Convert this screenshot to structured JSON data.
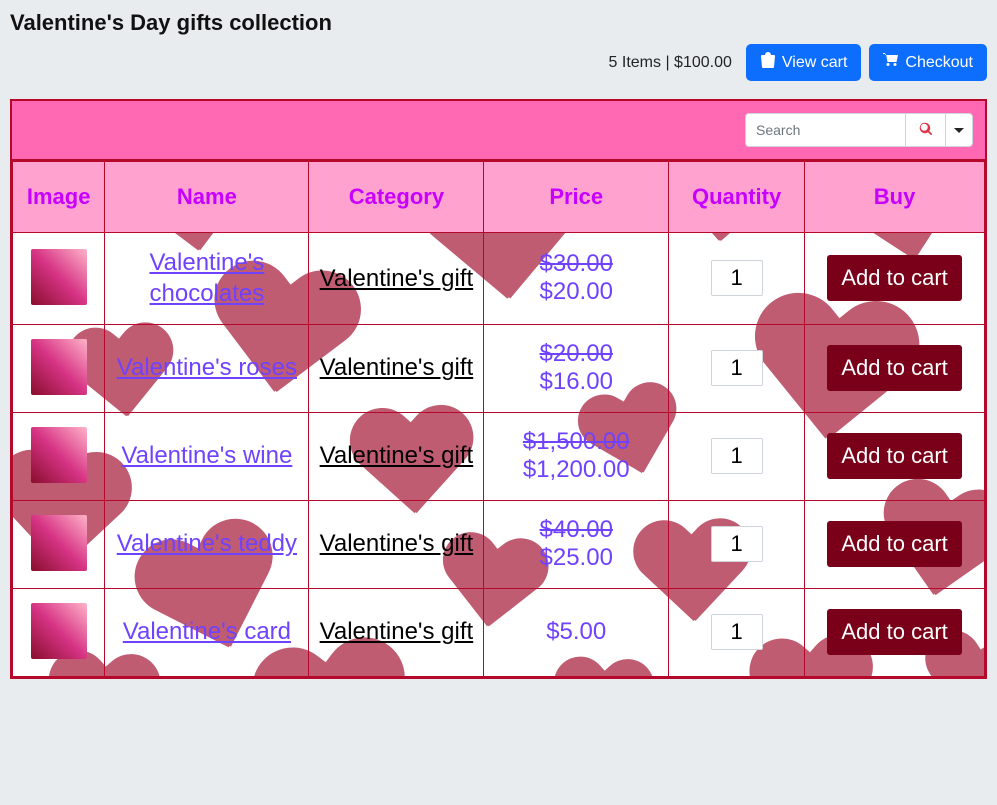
{
  "title": "Valentine's Day gifts collection",
  "cart": {
    "summary": "5 Items | $100.00",
    "view_label": "View cart",
    "checkout_label": "Checkout"
  },
  "search": {
    "placeholder": "Search"
  },
  "table": {
    "headers": {
      "image": "Image",
      "name": "Name",
      "category": "Category",
      "price": "Price",
      "quantity": "Quantity",
      "buy": "Buy"
    },
    "add_to_cart_label": "Add to cart",
    "rows": [
      {
        "name": "Valentine's chocolates",
        "category": "Valentine's gift",
        "old_price": "$30.00",
        "price": "$20.00",
        "qty": "1"
      },
      {
        "name": "Valentine's roses",
        "category": "Valentine's gift",
        "old_price": "$20.00",
        "price": "$16.00",
        "qty": "1"
      },
      {
        "name": "Valentine's wine",
        "category": "Valentine's gift",
        "old_price": "$1,500.00",
        "price": "$1,200.00",
        "qty": "1"
      },
      {
        "name": "Valentine's teddy",
        "category": "Valentine's gift",
        "old_price": "$40.00",
        "price": "$25.00",
        "qty": "1"
      },
      {
        "name": "Valentine's card",
        "category": "Valentine's gift",
        "old_price": "",
        "price": "$5.00",
        "qty": "1"
      }
    ]
  }
}
